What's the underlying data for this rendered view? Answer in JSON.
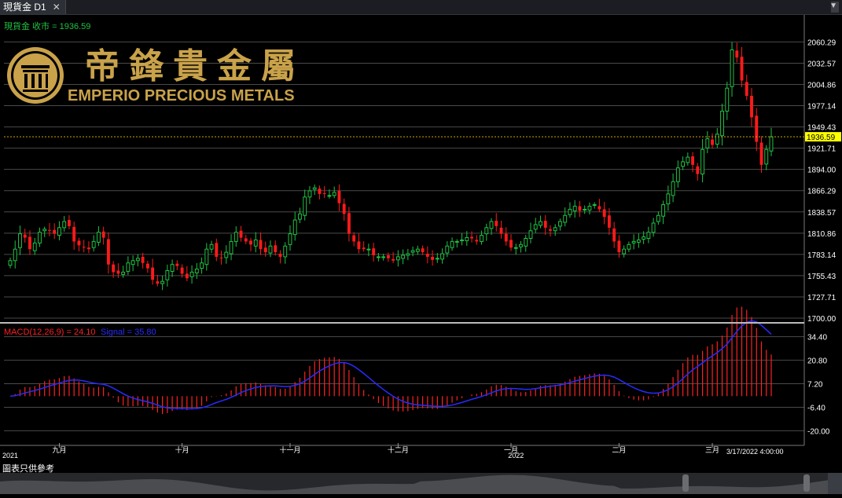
{
  "window": {
    "tab_label": "現貨金 D1",
    "close_glyph": "✕",
    "menu_glyph": "▼"
  },
  "logo": {
    "chinese_name": "帝鋒貴金屬",
    "english_name": "EMPERIO PRECIOUS METALS",
    "colors": {
      "gold": "#c9a24a"
    }
  },
  "colors": {
    "up": "#1fc243",
    "down": "#ff1a1a",
    "grid": "#4a4a4a",
    "axis_text": "#ffffff",
    "price_line": "#d4a800",
    "price_tag_bg": "#ffff00",
    "macd_hist": "#ff2020",
    "signal_line": "#2a2aff",
    "info_green": "#1fc243"
  },
  "footer": {
    "disclaimer": "圖表只供參考"
  },
  "chart_data": [
    {
      "type": "candlestick",
      "title": "",
      "info_label": "現貨金 收市 = 1936.59",
      "current_price": 1936.59,
      "current_price_label": "1936.59",
      "ylim": [
        1700.0,
        2073.0
      ],
      "y_ticks": [
        2060.29,
        2032.57,
        2004.86,
        1977.14,
        1949.43,
        1921.71,
        1894.0,
        1866.29,
        1838.57,
        1810.86,
        1783.14,
        1755.43,
        1727.71,
        1700.0
      ],
      "y_tick_labels": [
        "2060.29",
        "2032.57",
        "2004.86",
        "1977.14",
        "1949.43",
        "1921.71",
        "1894.00",
        "1866.29",
        "1838.57",
        "1810.86",
        "1783.14",
        "1755.43",
        "1727.71",
        "1700.00"
      ],
      "x_labels": [
        {
          "index": 0,
          "label": "2021"
        },
        {
          "index": 10,
          "label": "九月"
        },
        {
          "index": 35,
          "label": "十月"
        },
        {
          "index": 57,
          "label": "十一月"
        },
        {
          "index": 79,
          "label": "十二月"
        },
        {
          "index": 102,
          "label": "一月"
        },
        {
          "index": 103,
          "label": "2022"
        },
        {
          "index": 124,
          "label": "二月"
        },
        {
          "index": 143,
          "label": "三月"
        }
      ],
      "last_date_label": "3/17/2022 4:00:00",
      "closes": [
        1775,
        1790,
        1810,
        1805,
        1790,
        1798,
        1812,
        1816,
        1814,
        1810,
        1818,
        1826,
        1820,
        1800,
        1795,
        1792,
        1790,
        1800,
        1812,
        1805,
        1770,
        1760,
        1758,
        1760,
        1772,
        1775,
        1778,
        1772,
        1765,
        1750,
        1745,
        1748,
        1762,
        1770,
        1768,
        1758,
        1752,
        1760,
        1764,
        1772,
        1790,
        1796,
        1780,
        1778,
        1786,
        1800,
        1812,
        1805,
        1800,
        1796,
        1802,
        1790,
        1786,
        1794,
        1786,
        1780,
        1794,
        1810,
        1828,
        1836,
        1858,
        1866,
        1870,
        1862,
        1862,
        1860,
        1864,
        1850,
        1836,
        1810,
        1800,
        1790,
        1790,
        1790,
        1782,
        1780,
        1780,
        1778,
        1775,
        1780,
        1782,
        1784,
        1788,
        1790,
        1786,
        1780,
        1776,
        1778,
        1784,
        1794,
        1800,
        1800,
        1802,
        1805,
        1804,
        1800,
        1808,
        1818,
        1826,
        1820,
        1810,
        1800,
        1792,
        1792,
        1796,
        1804,
        1814,
        1822,
        1826,
        1818,
        1814,
        1818,
        1826,
        1834,
        1842,
        1846,
        1840,
        1842,
        1846,
        1848,
        1842,
        1832,
        1818,
        1800,
        1786,
        1790,
        1796,
        1800,
        1802,
        1806,
        1812,
        1824,
        1834,
        1848,
        1862,
        1878,
        1896,
        1904,
        1910,
        1900,
        1888,
        1920,
        1934,
        1926,
        1940,
        1970,
        2000,
        2050,
        2040,
        2010,
        1990,
        1962,
        1930,
        1900,
        1920,
        1936.59
      ],
      "macd": {
        "label": "MACD(12,26,9) = 24.10",
        "signal_label": "Signal = 35.80",
        "ylim": [
          -23.0,
          40.6
        ],
        "y_ticks": [
          34.4,
          20.8,
          7.2,
          -6.4,
          -20.0
        ],
        "y_tick_labels": [
          "34.40",
          "20.80",
          "7.20",
          "-6.40",
          "-20.00"
        ],
        "last_macd": 24.1,
        "last_signal": 35.8
      }
    }
  ]
}
